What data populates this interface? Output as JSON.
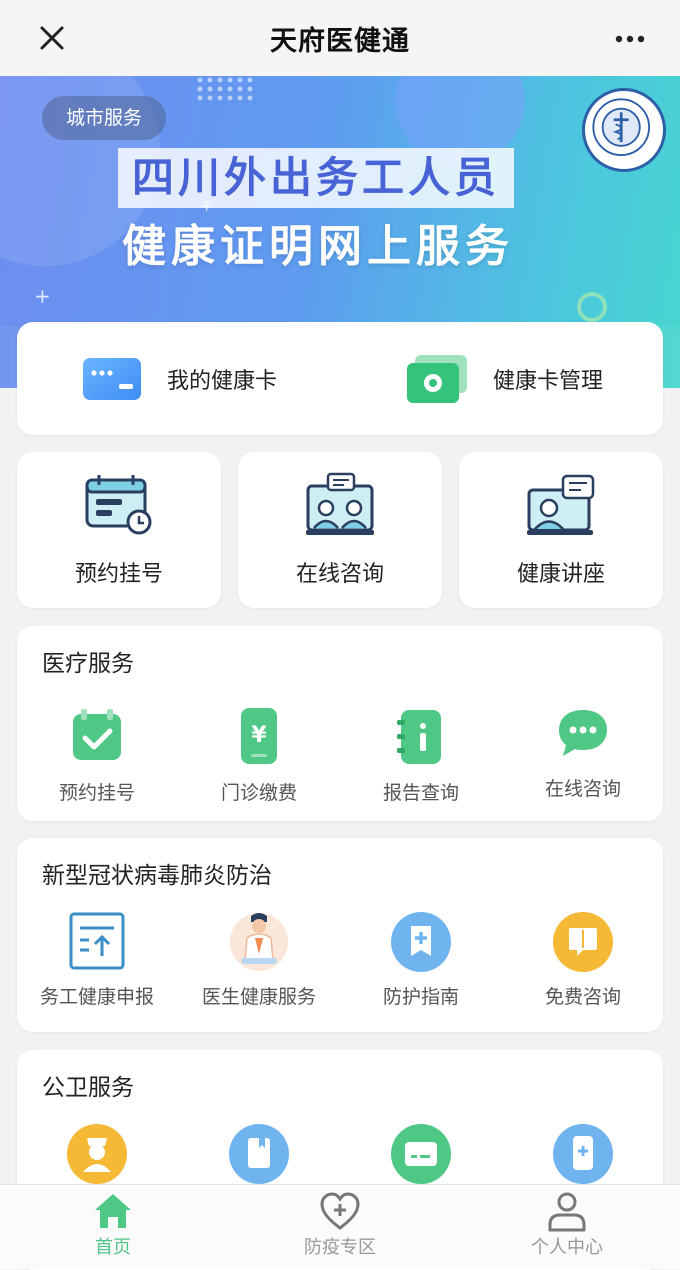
{
  "topbar": {
    "title": "天府医健通"
  },
  "banner": {
    "pill": "城市服务",
    "headline1": "四川外出务工人员",
    "headline2": "健康证明网上服务"
  },
  "health_card": [
    {
      "label": "我的健康卡",
      "icon": "health-card-icon"
    },
    {
      "label": "健康卡管理",
      "icon": "card-settings-icon"
    }
  ],
  "tiles": [
    {
      "label": "预约挂号",
      "icon": "calendar-clock-icon"
    },
    {
      "label": "在线咨询",
      "icon": "video-consult-icon"
    },
    {
      "label": "健康讲座",
      "icon": "lecture-icon"
    }
  ],
  "medical": {
    "title": "医疗服务",
    "items": [
      {
        "label": "预约挂号",
        "icon": "calendar-check-icon"
      },
      {
        "label": "门诊缴费",
        "icon": "payment-icon"
      },
      {
        "label": "报告查询",
        "icon": "report-icon"
      },
      {
        "label": "在线咨询",
        "icon": "chat-bubble-icon"
      }
    ]
  },
  "covid": {
    "title": "新型冠状病毒肺炎防治",
    "items": [
      {
        "label": "务工健康申报",
        "icon": "upload-form-icon"
      },
      {
        "label": "医生健康服务",
        "icon": "doctor-icon"
      },
      {
        "label": "防护指南",
        "icon": "guide-icon"
      },
      {
        "label": "免费咨询",
        "icon": "consult-book-icon"
      }
    ]
  },
  "public_health": {
    "title": "公卫服务",
    "items": [
      {
        "icon": "nurse-icon"
      },
      {
        "icon": "book-icon"
      },
      {
        "icon": "card-icon"
      },
      {
        "icon": "mobile-medical-icon"
      }
    ]
  },
  "nav": {
    "items": [
      {
        "label": "首页",
        "icon": "home-icon",
        "active": true
      },
      {
        "label": "防疫专区",
        "icon": "heart-plus-icon",
        "active": false
      },
      {
        "label": "个人中心",
        "icon": "user-icon",
        "active": false
      }
    ],
    "active_color": "#4fc785",
    "inactive_color": "#999999"
  }
}
